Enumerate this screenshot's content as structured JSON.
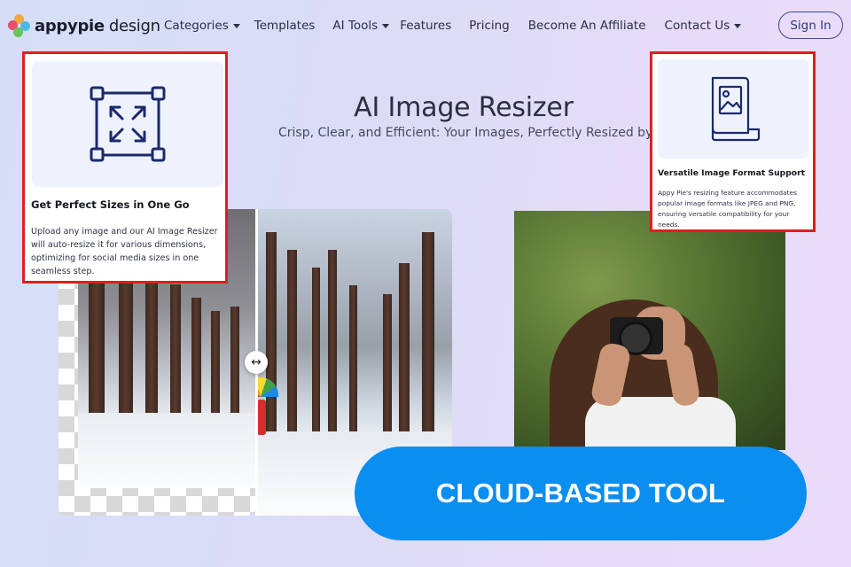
{
  "brand": {
    "name_bold": "appypie",
    "name_light": "design",
    "logo_colors": [
      "#f2a93b",
      "#e94f6f",
      "#4fb7e8",
      "#6cc25b"
    ]
  },
  "nav": {
    "items": [
      {
        "label": "Categories",
        "dropdown": true
      },
      {
        "label": "Templates",
        "dropdown": false
      },
      {
        "label": "AI Tools",
        "dropdown": true
      },
      {
        "label": "Features",
        "dropdown": false
      },
      {
        "label": "Pricing",
        "dropdown": false
      },
      {
        "label": "Become An Affiliate",
        "dropdown": false
      },
      {
        "label": "Contact Us",
        "dropdown": true
      }
    ],
    "signin_label": "Sign In"
  },
  "hero": {
    "title": "AI Image Resizer",
    "subtitle": "Crisp, Clear, and Efficient: Your Images, Perfectly Resized by AI."
  },
  "compare_handle_glyph": "↔",
  "features": {
    "left": {
      "icon": "resize-arrows-icon",
      "title": "Get Perfect Sizes in One Go",
      "desc": "Upload any image and our AI Image Resizer will auto-resize it for various dimensions, optimizing for social media sizes in one seamless step."
    },
    "right": {
      "icon": "image-file-icon",
      "title": "Versatile Image Format Support",
      "desc": "Appy Pie's resizing feature accommodates popular image formats like JPEG and PNG, ensuring versatile compatibility for your needs."
    }
  },
  "cta": {
    "label": "CLOUD-BASED TOOL",
    "color": "#0a8ef0"
  },
  "accent": {
    "highlight_border": "#e01e1e",
    "icon_navy": "#1b2a6b"
  }
}
